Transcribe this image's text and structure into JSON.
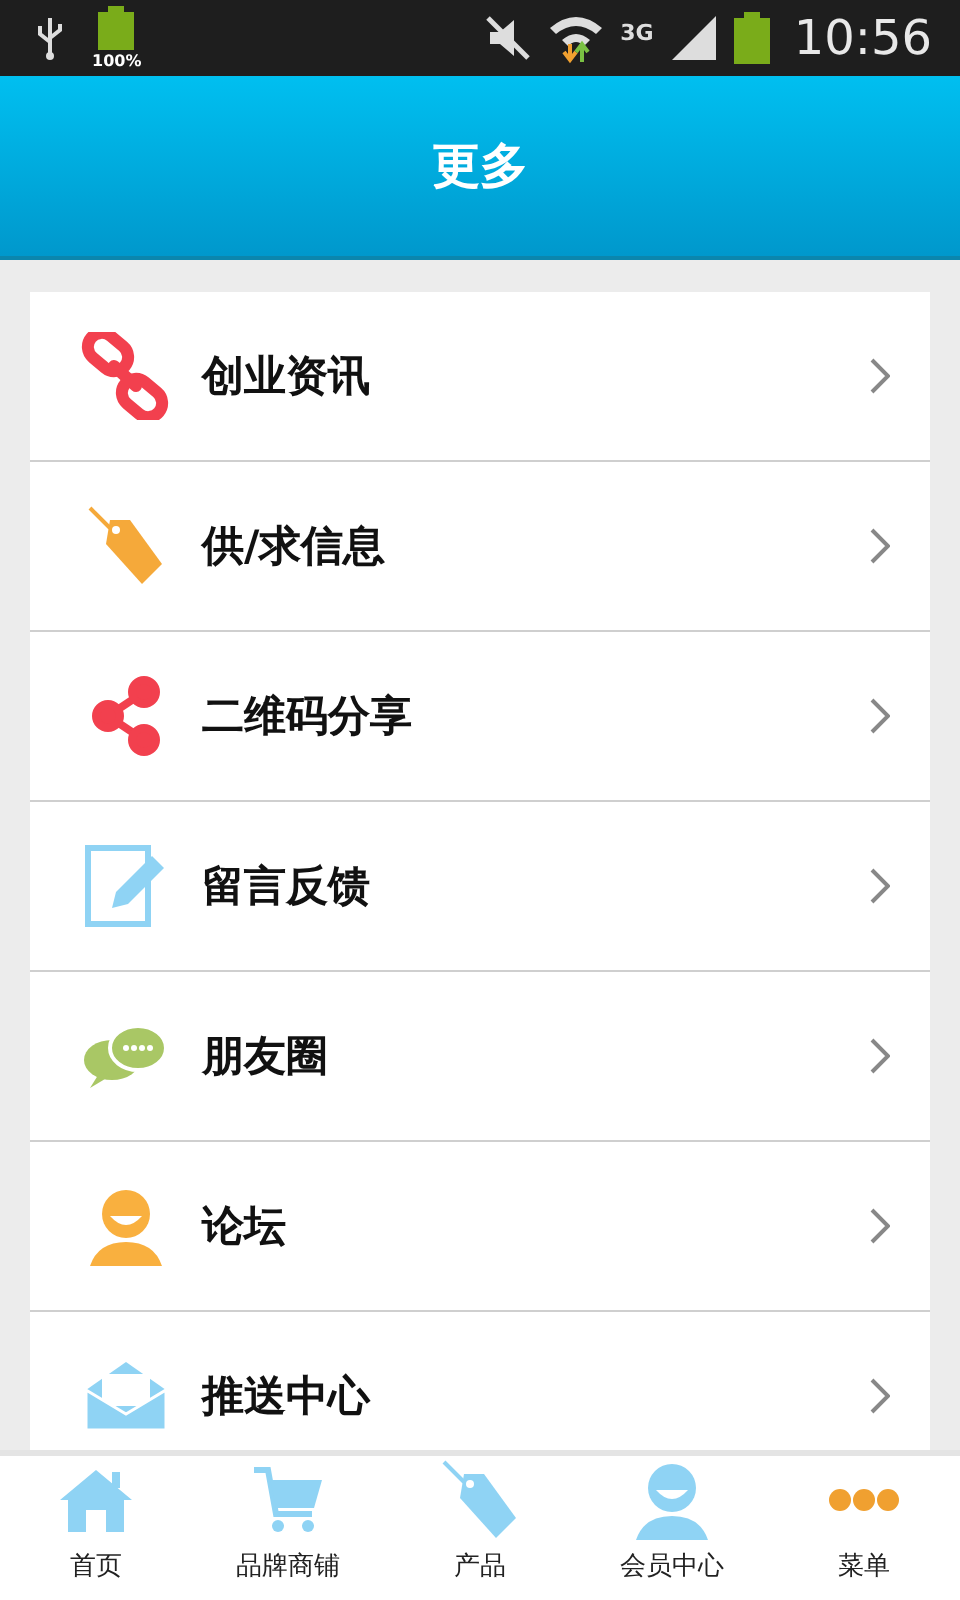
{
  "status_bar": {
    "battery_label": "100%",
    "network": "3G",
    "time": "10:56"
  },
  "header": {
    "title": "更多"
  },
  "menu_items": [
    {
      "label": "创业资讯"
    },
    {
      "label": "供/求信息"
    },
    {
      "label": "二维码分享"
    },
    {
      "label": "留言反馈"
    },
    {
      "label": "朋友圈"
    },
    {
      "label": "论坛"
    },
    {
      "label": "推送中心"
    }
  ],
  "bottom_nav": [
    {
      "label": "首页"
    },
    {
      "label": "品牌商铺"
    },
    {
      "label": "产品"
    },
    {
      "label": "会员中心"
    },
    {
      "label": "菜单"
    }
  ]
}
